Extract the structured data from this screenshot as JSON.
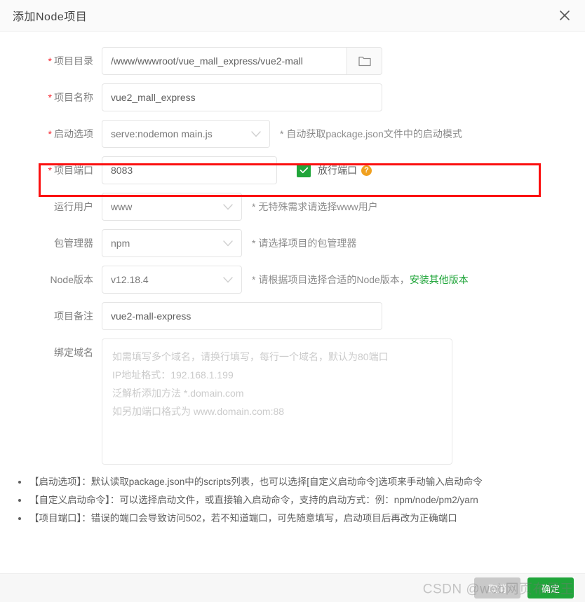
{
  "dialog": {
    "title": "添加Node项目",
    "close_icon": "close-icon"
  },
  "form": {
    "project_dir": {
      "label": "项目目录",
      "required_mark": "*",
      "value": "/www/wwwroot/vue_mall_express/vue2-mall",
      "folder_icon": "folder-icon"
    },
    "project_name": {
      "label": "项目名称",
      "required_mark": "*",
      "value": "vue2_mall_express"
    },
    "start_option": {
      "label": "启动选项",
      "required_mark": "*",
      "value": "serve:nodemon main.js",
      "hint": "* 自动获取package.json文件中的启动模式",
      "highlight_color": "#fb0f0f"
    },
    "project_port": {
      "label": "项目端口",
      "required_mark": "*",
      "value": "8083",
      "checkbox_label": "放行端口",
      "checkbox_checked": true,
      "checkbox_color": "#20a53a",
      "help_icon": "question-mark-icon",
      "help_glyph": "?"
    },
    "run_user": {
      "label": "运行用户",
      "value": "www",
      "hint": "* 无特殊需求请选择www用户"
    },
    "package_manager": {
      "label": "包管理器",
      "value": "npm",
      "hint": "* 请选择项目的包管理器"
    },
    "node_version": {
      "label": "Node版本",
      "value": "v12.18.4",
      "hint": "* 请根据项目选择合适的Node版本，",
      "link_text": "安装其他版本",
      "link_color": "#20a53a"
    },
    "project_remark": {
      "label": "项目备注",
      "value": "vue2-mall-express"
    },
    "bind_domain": {
      "label": "绑定域名",
      "value": "",
      "placeholder": "如需填写多个域名，请换行填写，每行一个域名，默认为80端口\nIP地址格式：192.168.1.199\n泛解析添加方法 *.domain.com\n如另加端口格式为 www.domain.com:88"
    }
  },
  "tips": [
    "【启动选项】：默认读取package.json中的scripts列表，也可以选择[自定义启动命令]选项来手动输入启动命令",
    "【自定义启动命令】：可以选择启动文件，或直接输入启动命令，支持的启动方式：例：npm/node/pm2/yarn",
    "【项目端口】：错误的端口会导致访问502，若不知道端口，可先随意填写，启动项目后再改为正确端口"
  ],
  "footer": {
    "cancel_label": "取消",
    "confirm_label": "确定",
    "watermark": "CSDN @web网页布局王"
  }
}
